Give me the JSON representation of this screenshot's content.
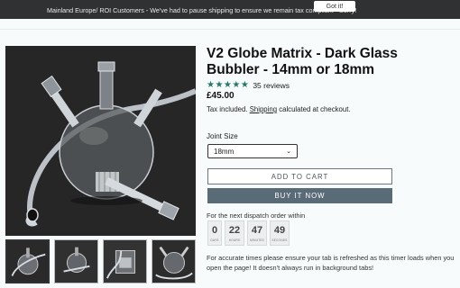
{
  "announcement": {
    "message": "Mainland Europe/ ROI Customers - We've had to pause shipping to ensure we remain tax compliant - Sorry!",
    "button": "Got it!"
  },
  "product": {
    "title": "V2 Globe Matrix - Dark Glass Bubbler - 14mm or 18mm",
    "stars": "★★★★★",
    "rating_value": 5,
    "reviews": "35 reviews",
    "price": "£45.00",
    "tax_prefix": "Tax included.",
    "shipping_link": "Shipping",
    "tax_suffix": "calculated at checkout."
  },
  "options": {
    "label": "Joint Size",
    "selected": "18mm"
  },
  "actions": {
    "add_to_cart": "ADD TO CART",
    "buy_now": "BUY IT NOW"
  },
  "dispatch": {
    "label": "For the next dispatch order within",
    "timer": [
      {
        "value": "0",
        "unit": "DAYS"
      },
      {
        "value": "22",
        "unit": "HOURS"
      },
      {
        "value": "47",
        "unit": "MINUTES"
      },
      {
        "value": "49",
        "unit": "SECONDS"
      }
    ],
    "note": "For accurate times please ensure your tab is refreshed as this timer loads when you open the page! It doesn't always run in background tabs!"
  },
  "colors": {
    "announcement_bg": "#2f3133",
    "star": "#1f7a6b",
    "buy_now_bg": "#5a6b78"
  }
}
